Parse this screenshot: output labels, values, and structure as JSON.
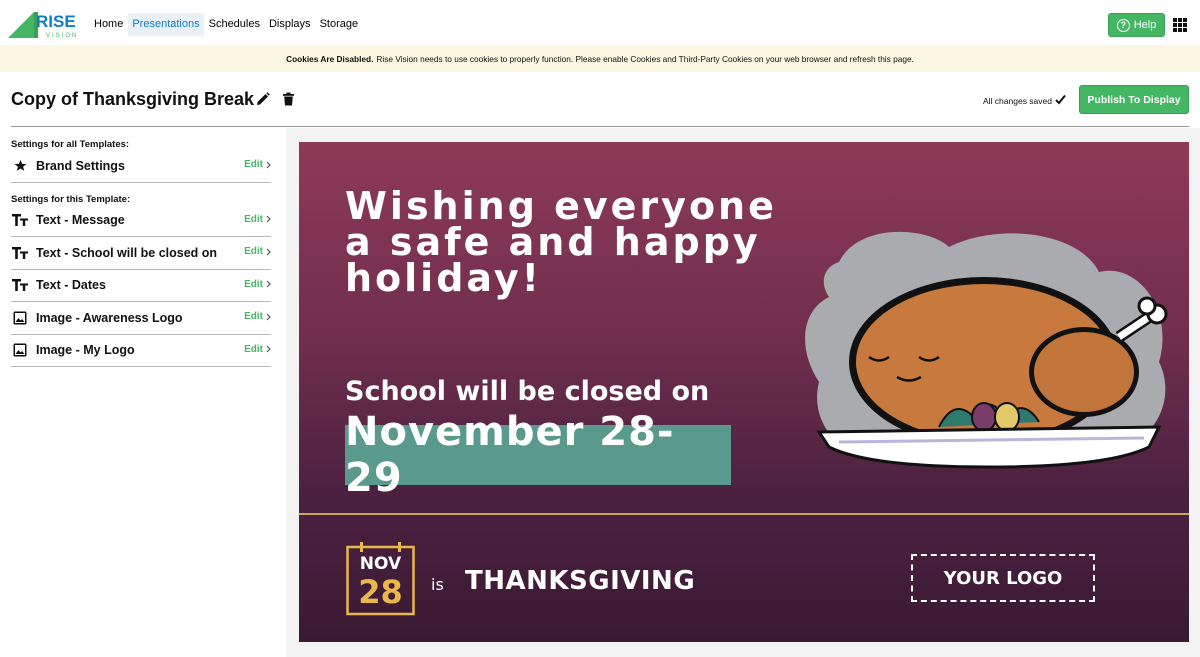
{
  "nav": {
    "brand_top": "RISE",
    "brand_bottom": "VISION",
    "items": [
      {
        "label": "Home"
      },
      {
        "label": "Presentations",
        "active": true
      },
      {
        "label": "Schedules"
      },
      {
        "label": "Displays"
      },
      {
        "label": "Storage"
      }
    ],
    "help_label": "Help",
    "help_icon": "question-circle-icon",
    "apps_icon": "grid-apps-icon"
  },
  "cookie_banner": {
    "bold": "Cookies Are Disabled.",
    "text": "Rise Vision needs to use cookies to properly function. Please enable Cookies and Third-Party Cookies on your web browser and refresh this page."
  },
  "presentation": {
    "title": "Copy of Thanksgiving Break",
    "saved_status": "All changes saved",
    "publish_label": "Publish To Display"
  },
  "settings": {
    "all_templates_label": "Settings for all Templates:",
    "this_template_label": "Settings for this Template:",
    "edit_label": "Edit",
    "brand": {
      "label": "Brand Settings",
      "icon": "star-icon"
    },
    "items": [
      {
        "label": "Text - Message",
        "icon": "text-icon"
      },
      {
        "label": "Text - School will be closed on",
        "icon": "text-icon"
      },
      {
        "label": "Text - Dates",
        "icon": "text-icon"
      },
      {
        "label": "Image - Awareness Logo",
        "icon": "image-icon"
      },
      {
        "label": "Image - My Logo",
        "icon": "image-icon"
      }
    ]
  },
  "slide": {
    "message": "Wishing everyone a safe and happy holiday!",
    "closed_text": "School will be closed on",
    "dates": "November 28-29",
    "cal_month": "NOV",
    "cal_day": "28",
    "is_word": "is",
    "holiday": "THANKSGIVING",
    "logo_placeholder": "YOUR LOGO"
  },
  "colors": {
    "accent_green": "#45b764",
    "nav_active": "#107dc9",
    "slide_top": "#8e3a57",
    "slide_bottom": "#3a1a33",
    "dates_box": "#5a9a8c",
    "gold": "#e9b84a"
  }
}
